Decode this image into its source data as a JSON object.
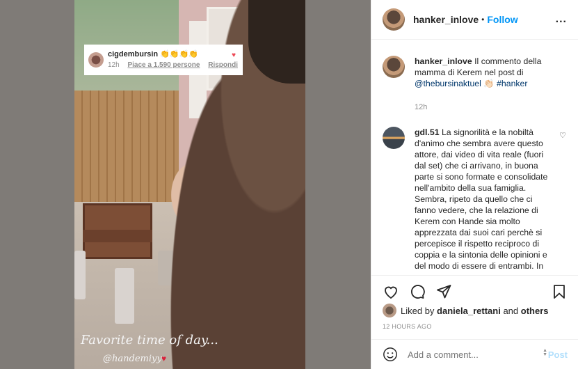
{
  "story": {
    "comment_user": "cigdembursin",
    "comment_emoji": "👏👏👏👏",
    "comment_time": "12h",
    "comment_likes": "Piace a 1.590 persone",
    "comment_reply": "Rispondi",
    "caption_line": "Favorite time of day...",
    "caption_tag": "@handemiyy"
  },
  "post": {
    "header": {
      "username": "hanker_inlove",
      "dot": "•",
      "follow_label": "Follow",
      "more": "..."
    },
    "caption": {
      "username": "hanker_inlove",
      "text": "Il commento della mamma di Kerem nel post di",
      "mention": "@thebursinaktuel",
      "emoji": "👏🏻",
      "hashtag": "#hanker",
      "time": "12h"
    },
    "comment": {
      "username": "gdl.51",
      "text": "La signorilità e la nobiltà d'animo che sembra avere questo attore, dai video di vita reale (fuori dal set) che ci arrivano, in buona parte si sono formate e consolidate nell'ambito della sua famiglia. Sembra, ripeto da quello che ci fanno vedere, che la relazione di Kerem con Hande sia molto apprezzata dai suoi cari perchè si percepisce il rispetto reciproco di coppia e la sintonia delle opinioni e del modo di essere di entrambi. In concreto"
    },
    "likes": {
      "prefix": "Liked by",
      "user": "daniela_rettani",
      "and": "and",
      "others": "others"
    },
    "timestamp": "12 HOURS AGO",
    "add_comment_placeholder": "Add a comment...",
    "post_label": "Post"
  }
}
